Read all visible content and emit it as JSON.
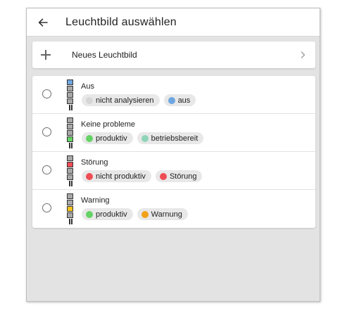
{
  "header": {
    "title": "Leuchtbild auswählen",
    "back_icon": "arrow-left-icon"
  },
  "new_item": {
    "label": "Neues Leuchtbild",
    "icon": "plus-icon",
    "trailing_icon": "chevron-right-icon"
  },
  "colors": {
    "grey_dot": "#d6d6d6",
    "blue": "#6ea6e0",
    "green": "#65d365",
    "teal": "#8fd4b8",
    "red": "#ef4d55",
    "orange": "#f3a01a",
    "yellow": "#f6c21c",
    "lamp_off": "#a9a9a9"
  },
  "items": [
    {
      "title": "Aus",
      "lamp": [
        "#6ea6e0",
        "#a9a9a9",
        "#a9a9a9",
        "#a9a9a9"
      ],
      "chips": [
        {
          "label": "nicht analysieren",
          "color": "#d6d6d6"
        },
        {
          "label": "aus",
          "color": "#6ea6e0"
        }
      ]
    },
    {
      "title": "Keine probleme",
      "lamp": [
        "#a9a9a9",
        "#a9a9a9",
        "#a9a9a9",
        "#65d365"
      ],
      "chips": [
        {
          "label": "produktiv",
          "color": "#65d365"
        },
        {
          "label": "betriebsbereit",
          "color": "#8fd4b8"
        }
      ]
    },
    {
      "title": "Störung",
      "lamp": [
        "#a9a9a9",
        "#ef4d55",
        "#a9a9a9",
        "#a9a9a9"
      ],
      "chips": [
        {
          "label": "nicht produktiv",
          "color": "#ef4d55"
        },
        {
          "label": "Störung",
          "color": "#ef4d55"
        }
      ]
    },
    {
      "title": "Warning",
      "lamp": [
        "#a9a9a9",
        "#a9a9a9",
        "#f6c21c",
        "#a9a9a9"
      ],
      "chips": [
        {
          "label": "produktiv",
          "color": "#65d365"
        },
        {
          "label": "Warnung",
          "color": "#f3a01a"
        }
      ]
    }
  ]
}
